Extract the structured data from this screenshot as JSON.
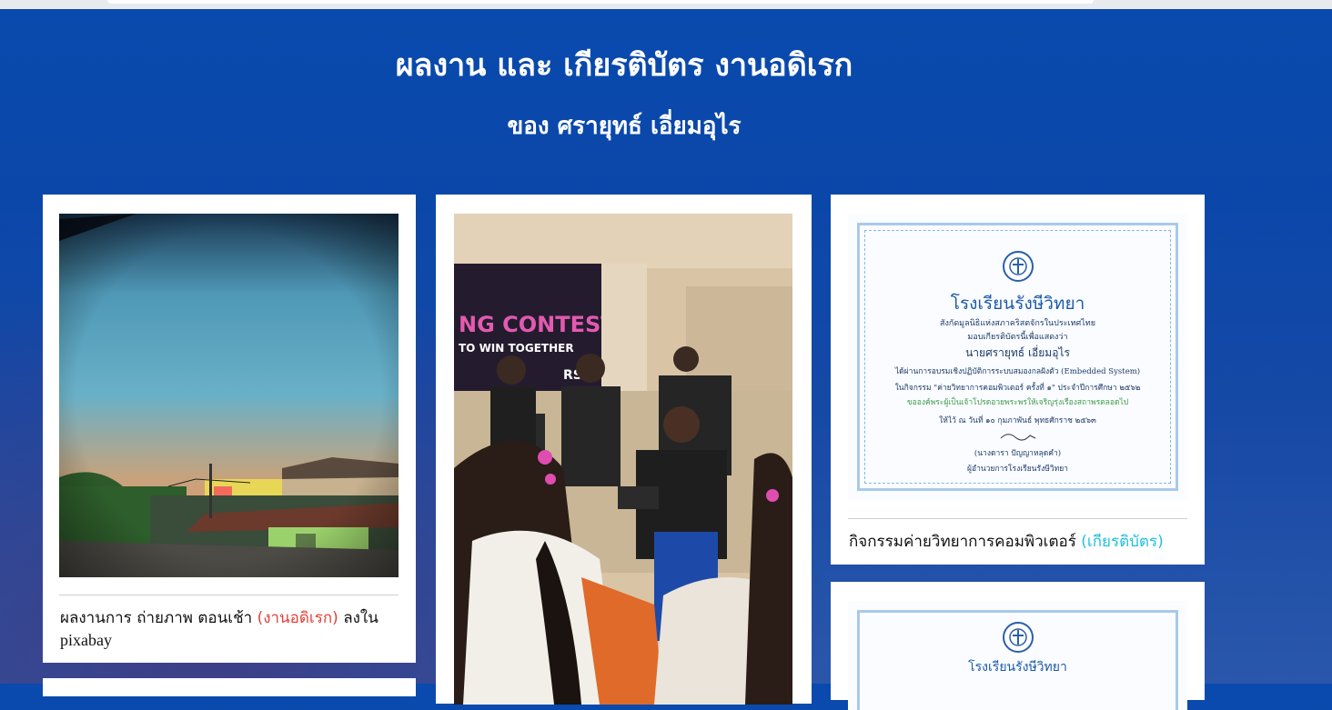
{
  "header": {
    "title": "ผลงาน และ เกียรติบัตร งานอดิเรก",
    "subtitle": "ของ ศรายุทธ์ เอี่ยมอุไร"
  },
  "cards": [
    {
      "caption_main": "ผลงานการ ถ่ายภาพ ตอนเช้า",
      "caption_tag": "(งานอดิเรก)",
      "caption_tail": "ลงใน",
      "caption_line2": "pixabay"
    },
    {
      "photo_text_contest": "NG CONTEST",
      "photo_text_together": "TO WIN TOGETHER",
      "photo_text_rsv": "RSV"
    },
    {
      "caption_main": "กิจกรรมค่ายวิทยาการคอมพิวเตอร์",
      "caption_tag": "(เกียรติบัตร)",
      "cert_school": "โรงเรียนรังษีวิทยา",
      "cert_line1": "สังกัดมูลนิธิแห่งสภาคริสตจักรในประเทศไทย",
      "cert_line2": "มอบเกียรติบัตรนี้เพื่อแสดงว่า",
      "cert_name": "นายศรายุทธ์ เอี่ยมอุไร",
      "cert_line3": "ได้ผ่านการอบรมเชิงปฏิบัติการระบบสมองกลฝังตัว (Embedded System)",
      "cert_line4": "ในกิจกรรม \"ค่ายวิทยาการคอมพิวเตอร์ ครั้งที่ ๑\" ประจำปีการศึกษา ๒๕๖๒",
      "cert_line5": "ขอองค์พระผู้เป็นเจ้าโปรดอวยพระพรให้เจริญรุ่งเรืองสถาพรตลอดไป",
      "cert_line6": "ให้ไว้ ณ วันที่ ๑๐ กุมภาพันธ์ พุทธศักราช ๒๕๖๓",
      "cert_signer": "(นางดารา ปัญญาหลุดคำ)",
      "cert_signer_title": "ผู้อำนวยการโรงเรียนรังษีวิทยา"
    },
    {
      "cert_school": "โรงเรียนรังษีวิทยา"
    }
  ],
  "colors": {
    "tag_red": "#e0433a",
    "tag_cyan": "#21c0de",
    "background_blue": "#0b47a9"
  }
}
